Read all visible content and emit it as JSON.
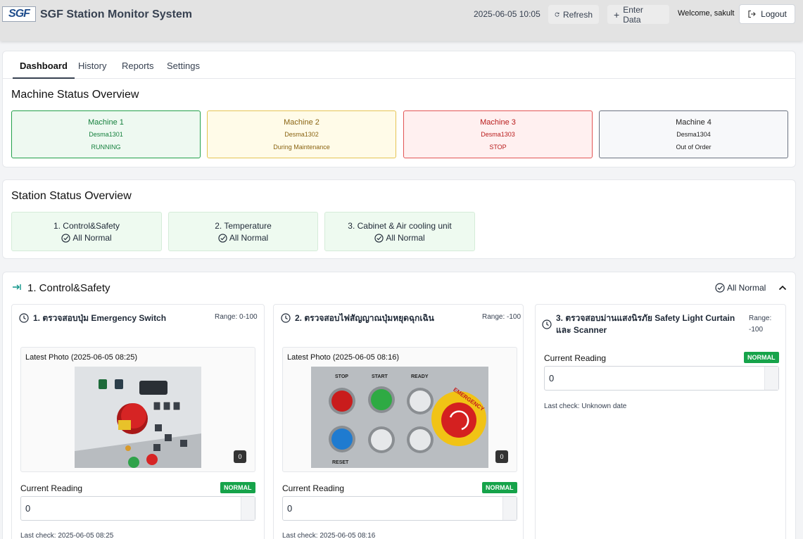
{
  "app": {
    "logo_text": "SGF",
    "title": "SGF Station Monitor System"
  },
  "header": {
    "datetime": "2025-06-05 10:05",
    "refresh_label": "Refresh",
    "enter_data_label": "Enter Data",
    "welcome": "Welcome, sakult",
    "logout_label": "Logout"
  },
  "tabs": [
    {
      "label": "Dashboard",
      "active": true
    },
    {
      "label": "History"
    },
    {
      "label": "Reports"
    },
    {
      "label": "Settings"
    }
  ],
  "machine_overview": {
    "title": "Machine Status Overview",
    "machines": [
      {
        "name": "Machine 1",
        "code": "Desma1301",
        "status": "RUNNING"
      },
      {
        "name": "Machine 2",
        "code": "Desma1302",
        "status": "During Maintenance"
      },
      {
        "name": "Machine 3",
        "code": "Desma1303",
        "status": "STOP"
      },
      {
        "name": "Machine 4",
        "code": "Desma1304",
        "status": "Out of Order"
      }
    ]
  },
  "station_overview": {
    "title": "Station Status Overview",
    "stations": [
      {
        "name": "1. Control&Safety",
        "status": "All Normal"
      },
      {
        "name": "2. Temperature",
        "status": "All Normal"
      },
      {
        "name": "3. Cabinet & Air cooling unit",
        "status": "All Normal"
      }
    ]
  },
  "section": {
    "title": "1. Control&Safety",
    "status": "All Normal",
    "checks": [
      {
        "title": "1. ตรวจสอบปุ่ม Emergency Switch",
        "range": "Range: 0-100",
        "photo_label": "Latest Photo (2025-06-05 08:25)",
        "photo_count": "0",
        "reading_label": "Current Reading",
        "badge": "NORMAL",
        "value": "0",
        "last_check": "Last check: 2025-06-05 08:25"
      },
      {
        "title": "2. ตรวจสอบไฟสัญญาณปุ่มหยุดฉุกเฉิน",
        "range": "Range: -100",
        "photo_label": "Latest Photo (2025-06-05 08:16)",
        "photo_count": "0",
        "reading_label": "Current Reading",
        "badge": "NORMAL",
        "value": "0",
        "last_check": "Last check: 2025-06-05 08:16"
      },
      {
        "title": "3. ตรวจสอบม่านแสงนิรภัย Safety Light Curtain และ Scanner",
        "range": "Range: -100",
        "reading_label": "Current Reading",
        "badge": "NORMAL",
        "value": "0",
        "last_check": "Last check: Unknown date"
      }
    ]
  },
  "photo_texts": {
    "stop": "STOP",
    "start": "START",
    "ready": "READY",
    "reset": "RESET",
    "emergency": "EMERGENCY"
  }
}
